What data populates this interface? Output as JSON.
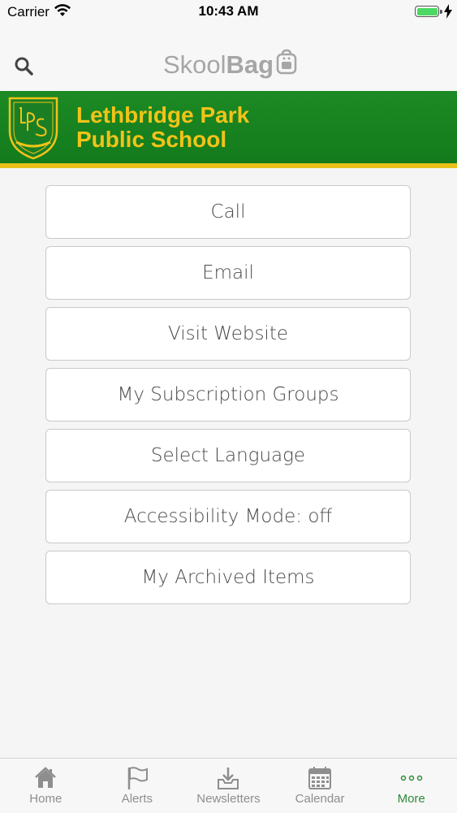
{
  "status_bar": {
    "carrier": "Carrier",
    "time": "10:43 AM"
  },
  "header": {
    "brand_skool": "Skool",
    "brand_bag": "Bag",
    "search_icon": "search-icon"
  },
  "school": {
    "name_line1": "Lethbridge Park",
    "name_line2": "Public School",
    "banner_color": "#1a8522",
    "stripe_color": "#e8c21a",
    "text_color": "#f2c318"
  },
  "menu": {
    "items": [
      {
        "label": "Call"
      },
      {
        "label": "Email"
      },
      {
        "label": "Visit Website"
      },
      {
        "label": "My Subscription Groups"
      },
      {
        "label": "Select Language"
      },
      {
        "label": "Accessibility Mode: off"
      },
      {
        "label": "My Archived Items"
      }
    ]
  },
  "tab_bar": {
    "active_color": "#2e8b3a",
    "tabs": [
      {
        "label": "Home",
        "icon": "home-icon"
      },
      {
        "label": "Alerts",
        "icon": "flag-icon"
      },
      {
        "label": "Newsletters",
        "icon": "inbox-download-icon"
      },
      {
        "label": "Calendar",
        "icon": "calendar-icon"
      },
      {
        "label": "More",
        "icon": "more-dots-icon",
        "active": true
      }
    ]
  }
}
